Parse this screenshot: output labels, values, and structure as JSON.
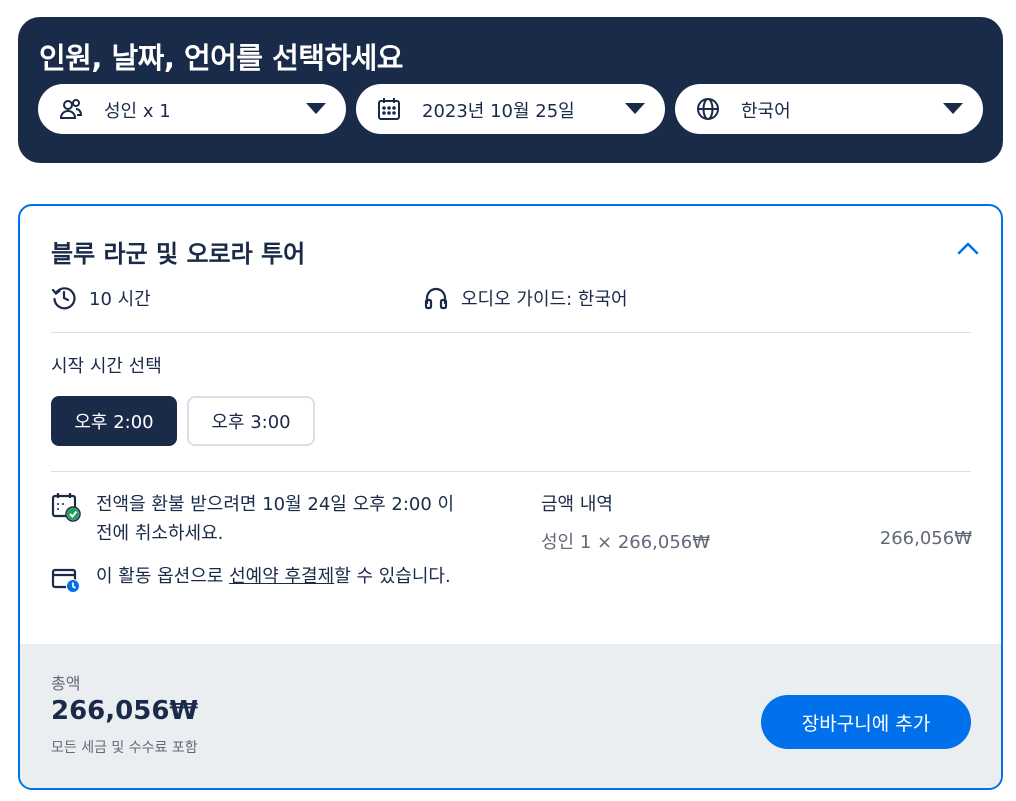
{
  "selector": {
    "title": "인원, 날짜, 언어를 선택하세요",
    "people": {
      "label": "성인 x 1",
      "icon": "people-icon"
    },
    "date": {
      "label": "2023년 10월 25일",
      "icon": "calendar-icon"
    },
    "language": {
      "label": "한국어",
      "icon": "globe-icon"
    }
  },
  "tour": {
    "title": "블루 라군 및 오로라 투어",
    "duration": "10 시간",
    "audio_guide": "오디오 가이드: 한국어",
    "start_time_label": "시작 시간 선택",
    "times": [
      {
        "label": "오후 2:00",
        "selected": true
      },
      {
        "label": "오후 3:00",
        "selected": false
      }
    ],
    "refund_policy": "전액을 환불 받으려면 10월 24일 오후 2:00 이전에 취소하세요.",
    "reserve_prefix": "이 활동 옵션으로 ",
    "reserve_link": "선예약 후결제",
    "reserve_suffix": "할 수 있습니다.",
    "price_breakdown_title": "금액 내역",
    "price_line": "성인 1 × 266,056₩",
    "price_line_amount": "266,056₩"
  },
  "footer": {
    "total_label": "총액",
    "total_amount": "266,056₩",
    "total_note": "모든 세금 및 수수료 포함",
    "add_to_cart": "장바구니에 추가"
  },
  "colors": {
    "navy": "#1a2b49",
    "accent": "#0071eb",
    "footer_bg": "#ebeef1"
  }
}
